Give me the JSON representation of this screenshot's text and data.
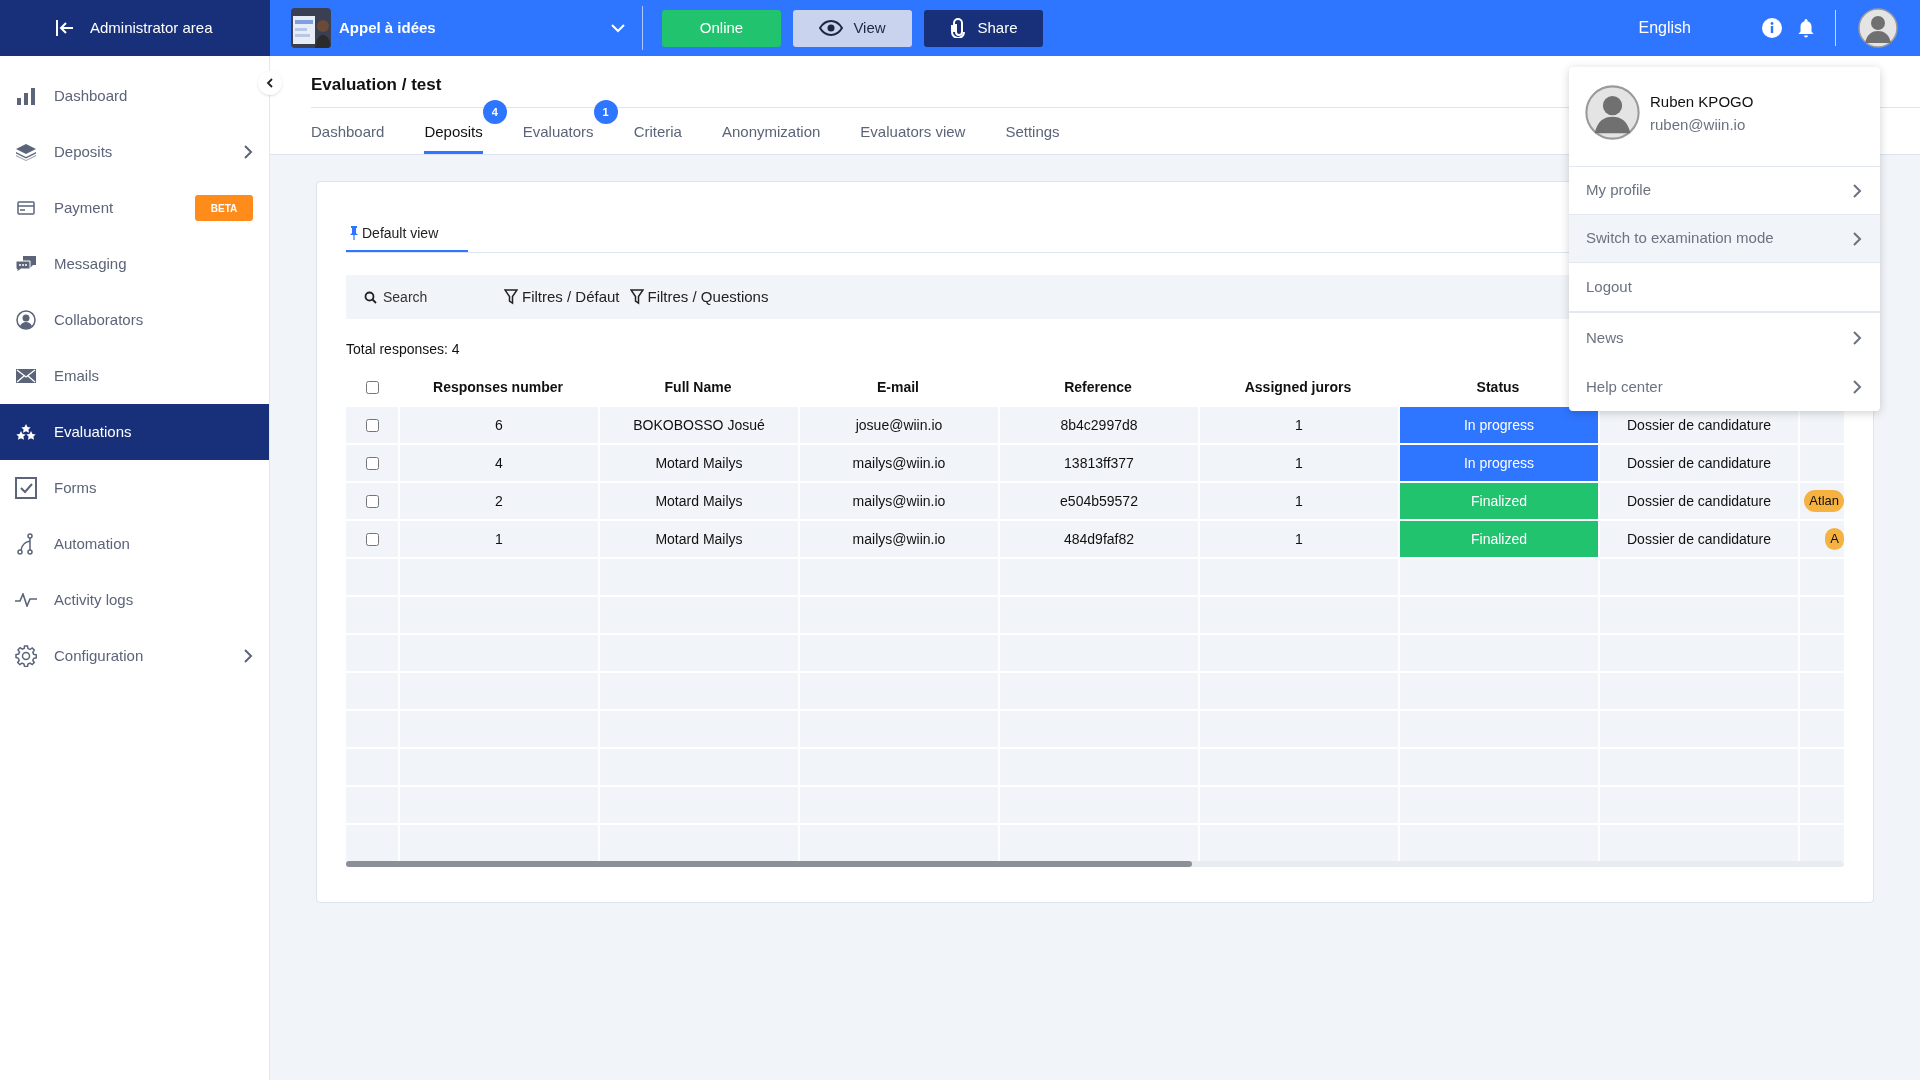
{
  "top_bar": {
    "admin_link": "Administrator area",
    "project": {
      "name": "Appel à idées"
    },
    "buttons": [
      {
        "label": "Online",
        "kind": "online"
      },
      {
        "label": "View",
        "kind": "view"
      },
      {
        "label": "Share",
        "kind": "share"
      }
    ],
    "language": "English"
  },
  "sidebar": {
    "items": [
      {
        "label": "Dashboard",
        "selected": false,
        "has_submenu": false
      },
      {
        "label": "Deposits",
        "selected": false,
        "has_submenu": true
      },
      {
        "label": "Payment",
        "selected": false,
        "has_submenu": false,
        "badge": "BETA"
      },
      {
        "label": "Messaging",
        "selected": false,
        "has_submenu": false
      },
      {
        "label": "Collaborators",
        "selected": false,
        "has_submenu": false
      },
      {
        "label": "Emails",
        "selected": false,
        "has_submenu": false
      },
      {
        "label": "Evaluations",
        "selected": true,
        "has_submenu": false
      },
      {
        "label": "Forms",
        "selected": false,
        "has_submenu": false
      },
      {
        "label": "Automation",
        "selected": false,
        "has_submenu": false
      },
      {
        "label": "Activity logs",
        "selected": false,
        "has_submenu": false
      },
      {
        "label": "Configuration",
        "selected": false,
        "has_submenu": true
      }
    ]
  },
  "page": {
    "title": "Evaluation / test",
    "tabs": [
      {
        "label": "Dashboard",
        "selected": false
      },
      {
        "label": "Deposits",
        "selected": true,
        "count": "4"
      },
      {
        "label": "Evaluators",
        "selected": false,
        "count": "1"
      },
      {
        "label": "Criteria",
        "selected": false
      },
      {
        "label": "Anonymization",
        "selected": false
      },
      {
        "label": "Evaluators view",
        "selected": false
      },
      {
        "label": "Settings",
        "selected": false
      }
    ]
  },
  "views": [
    {
      "label": "Default view",
      "selected": true
    }
  ],
  "toolbar": {
    "search": {
      "placeholder": "Search"
    },
    "filters": [
      "Filtres / Défaut",
      "Filtres / Questions"
    ]
  },
  "total": "Total responses: 4",
  "table": {
    "select_all": {
      "checked": false
    },
    "columns": [
      "Responses number",
      "Full Name",
      "E-mail",
      "Reference",
      "Assigned jurors",
      "Status"
    ],
    "rows": [
      {
        "checked": false,
        "cells": [
          "6",
          "BOKOBOSSO Josué",
          "josue@wiin.io",
          "8b4c2997d8",
          "1"
        ],
        "status": {
          "label": "In progress",
          "kind": "in_progress"
        },
        "column_7": "Dossier de candidature"
      },
      {
        "checked": false,
        "cells": [
          "4",
          "Motard Mailys",
          "mailys@wiin.io",
          "13813ff377",
          "1"
        ],
        "status": {
          "label": "In progress",
          "kind": "in_progress"
        },
        "column_7": "Dossier de candidature"
      },
      {
        "checked": false,
        "cells": [
          "2",
          "Motard Mailys",
          "mailys@wiin.io",
          "e504b59572",
          "1"
        ],
        "status": {
          "label": "Finalized",
          "kind": "finalized"
        },
        "column_7": "Dossier de candidature",
        "tag": "Atlan"
      },
      {
        "checked": false,
        "cells": [
          "1",
          "Motard Mailys",
          "mailys@wiin.io",
          "484d9faf82",
          "1"
        ],
        "status": {
          "label": "Finalized",
          "kind": "finalized"
        },
        "column_7": "Dossier de candidature",
        "tag": "A"
      }
    ]
  },
  "user_menu": {
    "name": "Ruben KPOGO",
    "email": "ruben@wiin.io",
    "items": [
      {
        "label": "My profile",
        "has_submenu": true,
        "selected": false
      },
      {
        "label": "Switch to examination mode",
        "has_submenu": true,
        "selected": true
      },
      {
        "label": "Logout",
        "has_submenu": false,
        "selected": false
      },
      {
        "label": "News",
        "has_submenu": true,
        "selected": false,
        "divider_before": true
      },
      {
        "label": "Help center",
        "has_submenu": true,
        "selected": false
      }
    ]
  }
}
